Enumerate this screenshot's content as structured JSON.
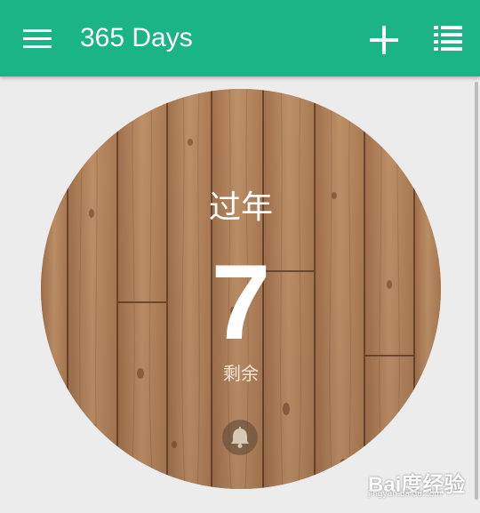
{
  "app_bar": {
    "title": "365 Days",
    "menu_icon": "hamburger-menu-icon",
    "add_icon": "plus-icon",
    "list_icon": "list-view-icon",
    "background_color": "#1ab486"
  },
  "event": {
    "title": "过年",
    "days": "7",
    "days_label": "剩余",
    "reminder_icon": "bell-icon",
    "background": "wood-texture"
  },
  "watermark": {
    "text": "Bai度经验",
    "subtext": "jingyan.baidu.com"
  }
}
